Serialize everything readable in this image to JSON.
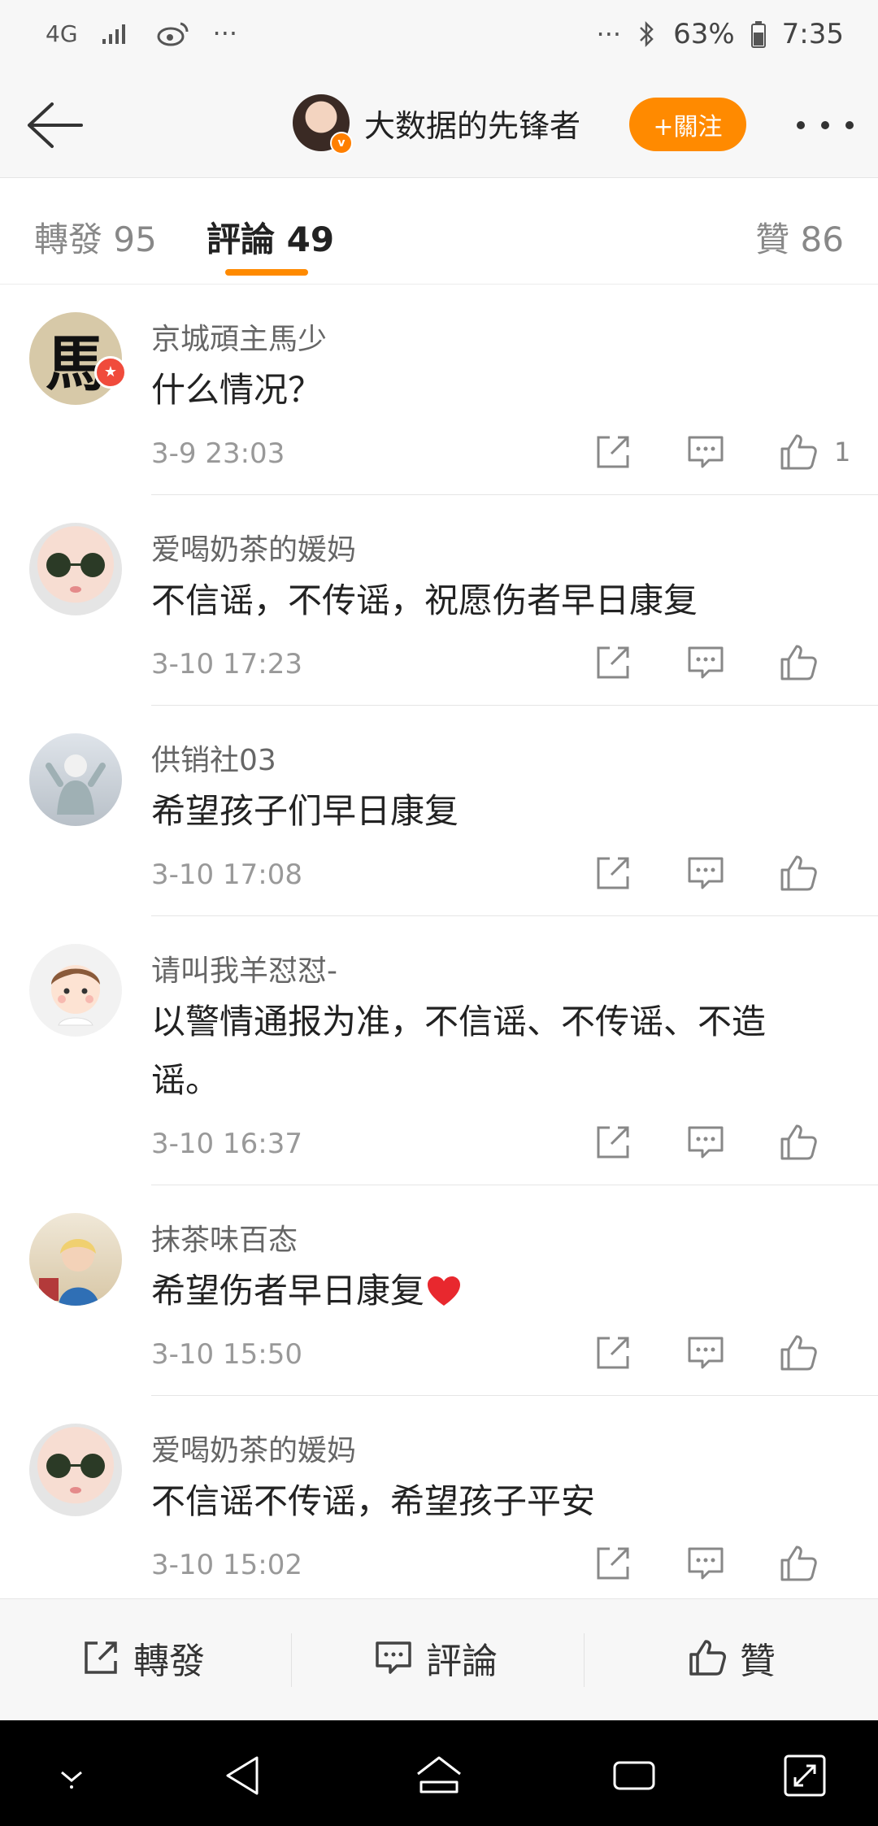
{
  "status_bar": {
    "network": "4G",
    "dots_left": "···",
    "dots_right": "···",
    "battery": "63%",
    "time": "7:35",
    "icons": [
      "signal-icon",
      "weibo-icon",
      "bluetooth-icon",
      "battery-icon"
    ]
  },
  "header": {
    "username": "大数据的先锋者",
    "verified_badge": "v",
    "follow_label": "+關注",
    "accent_color": "#ff8a00"
  },
  "tabs": [
    {
      "label": "轉發 95"
    },
    {
      "label": "評論 49"
    },
    {
      "label": "贊 86"
    }
  ],
  "comments": [
    {
      "name": "京城頑主馬少",
      "avatar_text": "馬",
      "text": "什么情况？",
      "time": "3-9 23:03",
      "likes": "1"
    },
    {
      "name": "爱喝奶茶的媛妈",
      "text": "不信谣，不传谣，祝愿伤者早日康复",
      "time": "3-10 17:23",
      "likes": ""
    },
    {
      "name": "供销社03",
      "text": "希望孩子们早日康复",
      "time": "3-10 17:08",
      "likes": ""
    },
    {
      "name": "请叫我羊怼怼-",
      "text": "以警情通报为准，不信谣、不传谣、不造谣。",
      "time": "3-10 16:37",
      "likes": ""
    },
    {
      "name": "抹茶味百态",
      "text": "希望伤者早日康复",
      "time": "3-10 15:50",
      "likes": ""
    },
    {
      "name": "爱喝奶茶的媛妈",
      "text": "不信谣不传谣，希望孩子平安",
      "time": "3-10 15:02",
      "likes": ""
    }
  ],
  "bottom_bar": {
    "repost_label": "轉發",
    "comment_label": "評論",
    "like_label": "贊"
  }
}
